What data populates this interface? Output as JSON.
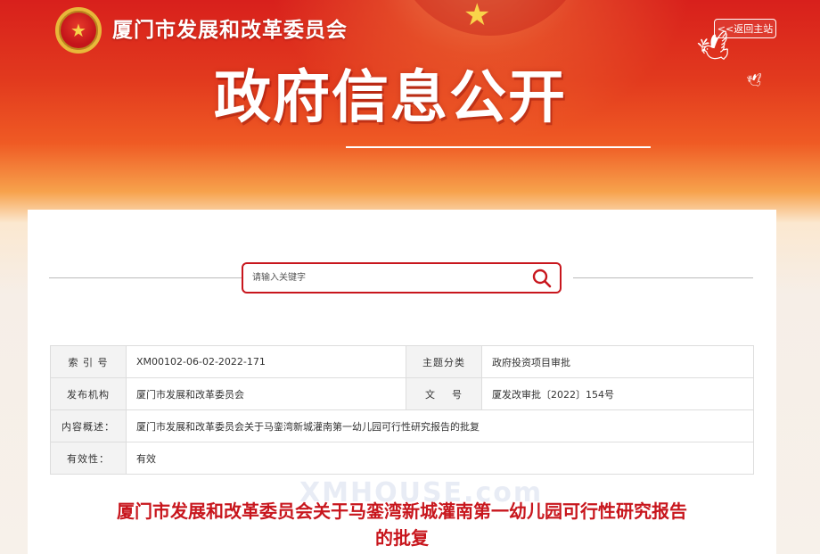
{
  "header": {
    "site_name": "厦门市发展和改革委员会",
    "home_link": "<<返回主站",
    "hero_title": "政府信息公开"
  },
  "search": {
    "placeholder": "请输入关键字"
  },
  "meta": {
    "rows": [
      [
        {
          "label": "索 引 号",
          "value": "XM00102-06-02-2022-171"
        },
        {
          "label": "主题分类",
          "value": "政府投资项目审批"
        }
      ],
      [
        {
          "label": "发布机构",
          "value": "厦门市发展和改革委员会"
        },
        {
          "label": "文    号",
          "value": "厦发改审批〔2022〕154号"
        }
      ]
    ],
    "summary_label": "内容概述：",
    "summary_value": "厦门市发展和改革委员会关于马銮湾新城灌南第一幼儿园可行性研究报告的批复",
    "validity_label": "有效性：",
    "validity_value": "有效"
  },
  "document": {
    "title_line1": "厦门市发展和改革委员会关于马銮湾新城灌南第一幼儿园可行性研究报告",
    "title_line2": "的批复"
  },
  "watermark": "XMHOUSE.com",
  "colors": {
    "brand_red": "#c8161d",
    "banner_red": "#d8201c"
  },
  "icons": {
    "emblem": "national-emblem-icon",
    "search": "search-icon",
    "dove": "dove-icon"
  }
}
